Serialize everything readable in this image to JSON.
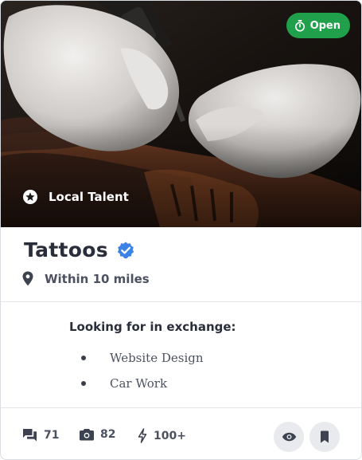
{
  "hero": {
    "image_alt": "Tattoo artist working with gloved hands",
    "status": "Open",
    "tag": "Local Talent"
  },
  "listing": {
    "title": "Tattoos",
    "verified": true,
    "location": "Within 10 miles"
  },
  "exchange": {
    "heading": "Looking for in exchange:",
    "items": [
      "Website Design",
      "Car Work"
    ]
  },
  "stats": {
    "comments": "71",
    "photos": "82",
    "activity": "100+"
  },
  "colors": {
    "status_green": "#20a04a",
    "verified_blue": "#3d82e6",
    "text_dark": "#2a2e3a"
  },
  "icons": [
    "timer-icon",
    "star-badge-icon",
    "verified-check-icon",
    "location-pin-icon",
    "comments-icon",
    "camera-icon",
    "bolt-icon",
    "eye-icon",
    "bookmark-icon"
  ]
}
